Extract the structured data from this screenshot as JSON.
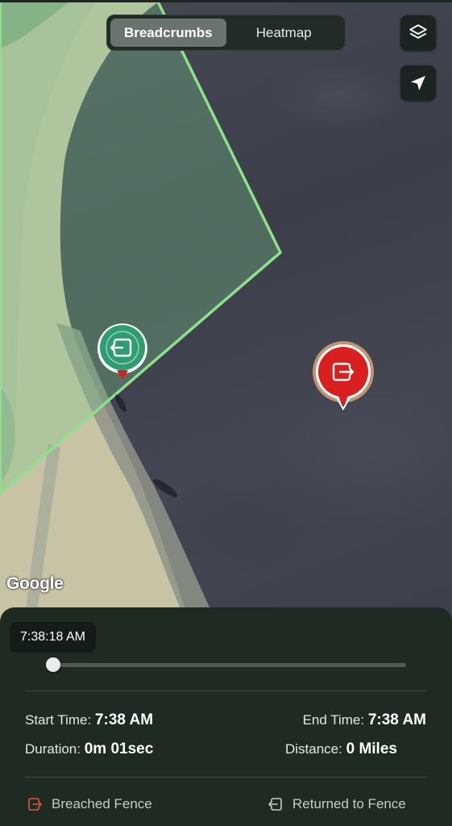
{
  "tabs": [
    {
      "label": "Breadcrumbs",
      "active": true
    },
    {
      "label": "Heatmap",
      "active": false
    }
  ],
  "map_controls": {
    "layers_icon": "layers-icon",
    "locate_icon": "navigation-arrow-icon"
  },
  "map": {
    "attribution": "Google",
    "fence_color": "#8fe08a",
    "markers": [
      {
        "type": "returned",
        "icon": "enter-arrow-icon",
        "color": "#2e9e72"
      },
      {
        "type": "breached",
        "icon": "exit-arrow-icon",
        "color": "#d91f1f"
      }
    ]
  },
  "playback": {
    "current_time": "7:38:18 AM",
    "progress": 0.0
  },
  "stats": {
    "start_label": "Start Time:",
    "start_value": "7:38 AM",
    "end_label": "End Time:",
    "end_value": "7:38 AM",
    "duration_label": "Duration:",
    "duration_value": "0m 01sec",
    "distance_label": "Distance:",
    "distance_value": "0 Miles"
  },
  "legend": {
    "breached_label": "Breached Fence",
    "breached_color": "#e0553b",
    "returned_label": "Returned to Fence",
    "returned_color": "#c6ccc8"
  }
}
